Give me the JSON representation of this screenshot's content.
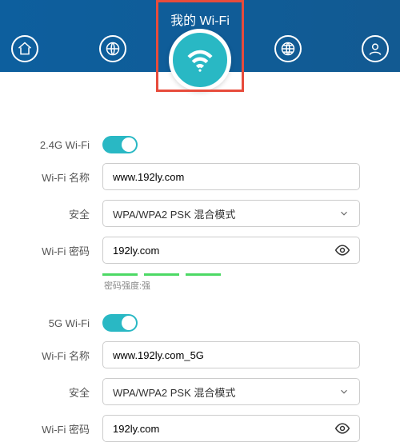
{
  "header": {
    "title": "我的 Wi-Fi"
  },
  "bands": {
    "g24": {
      "toggleLabel": "2.4G Wi-Fi",
      "nameLabel": "Wi-Fi 名称",
      "nameValue": "www.192ly.com",
      "securityLabel": "安全",
      "securityValue": "WPA/WPA2 PSK 混合模式",
      "passwordLabel": "Wi-Fi 密码",
      "passwordValue": "192ly.com",
      "strengthLabel": "密码强度:强"
    },
    "g5": {
      "toggleLabel": "5G Wi-Fi",
      "nameLabel": "Wi-Fi 名称",
      "nameValue": "www.192ly.com_5G",
      "securityLabel": "安全",
      "securityValue": "WPA/WPA2 PSK 混合模式",
      "passwordLabel": "Wi-Fi 密码",
      "passwordValue": "192ly.com"
    }
  }
}
